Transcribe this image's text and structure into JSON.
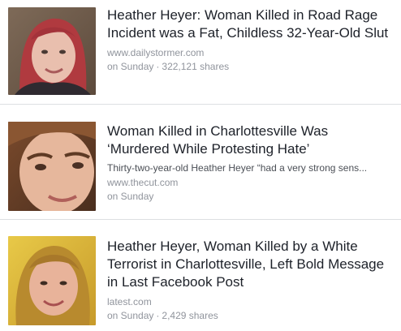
{
  "items": [
    {
      "title": "Heather Heyer: Woman Killed in Road Rage Incident was a Fat, Childless 32-Year-Old Slut",
      "snippet": "",
      "domain": "www.dailystormer.com",
      "time": "on Sunday",
      "separator": "·",
      "shares": "322,121 shares"
    },
    {
      "title": "Woman Killed in Charlottesville Was ‘Murdered While Protesting Hate’",
      "snippet": "Thirty-two-year-old Heather Heyer “had a very strong sens...",
      "domain": "www.thecut.com",
      "time": "on Sunday",
      "separator": "",
      "shares": ""
    },
    {
      "title": "Heather Heyer, Woman Killed by a White Terrorist in Charlottesville, Left Bold Message in Last Facebook Post",
      "snippet": "",
      "domain": "latest.com",
      "time": "on Sunday",
      "separator": "·",
      "shares": "2,429 shares"
    }
  ]
}
